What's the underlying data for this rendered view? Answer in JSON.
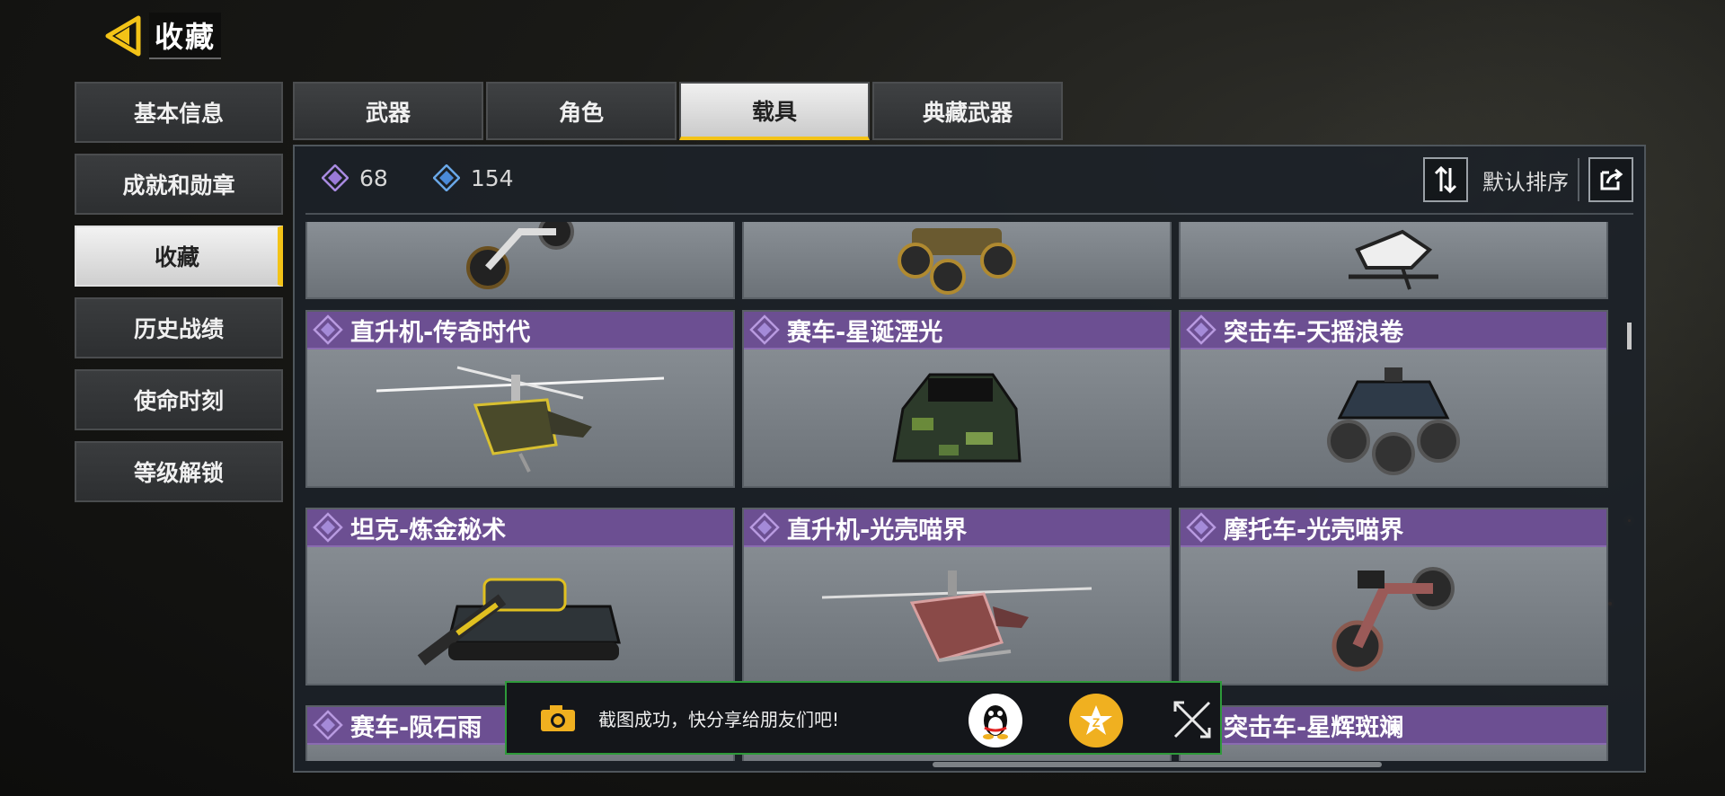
{
  "header": {
    "title": "收藏"
  },
  "side_menu": {
    "items": [
      {
        "label": "基本信息",
        "active": false
      },
      {
        "label": "成就和勋章",
        "active": false
      },
      {
        "label": "收藏",
        "active": true
      },
      {
        "label": "历史战绩",
        "active": false
      },
      {
        "label": "使命时刻",
        "active": false
      },
      {
        "label": "等级解锁",
        "active": false
      }
    ]
  },
  "tabs": [
    {
      "label": "武器",
      "active": false
    },
    {
      "label": "角色",
      "active": false
    },
    {
      "label": "载具",
      "active": true
    },
    {
      "label": "典藏武器",
      "active": false
    }
  ],
  "stats": {
    "purple_count": "68",
    "blue_count": "154"
  },
  "sort": {
    "label": "默认排序"
  },
  "vehicles": [
    {
      "name": "",
      "icon": "motorcycle-icon"
    },
    {
      "name": "",
      "icon": "atv-icon"
    },
    {
      "name": "",
      "icon": "snowmobile-icon"
    },
    {
      "name": "直升机-传奇时代",
      "icon": "helicopter-icon"
    },
    {
      "name": "赛车-星诞湮光",
      "icon": "race-car-icon"
    },
    {
      "name": "突击车-天摇浪卷",
      "icon": "assault-vehicle-icon"
    },
    {
      "name": "坦克-炼金秘术",
      "icon": "tank-icon"
    },
    {
      "name": "直升机-光壳喵界",
      "icon": "helicopter-icon"
    },
    {
      "name": "摩托车-光壳喵界",
      "icon": "motorcycle-icon"
    },
    {
      "name": "赛车-陨石雨",
      "icon": "race-car-icon"
    },
    {
      "name": "",
      "icon": "unknown"
    },
    {
      "name": "突击车-星辉斑斓",
      "icon": "assault-vehicle-icon"
    }
  ],
  "toast": {
    "message": "截图成功，快分享给朋友们吧!"
  },
  "colors": {
    "accent_yellow": "#f3c317",
    "rarity_purple": "#6c4f92",
    "toast_border": "#2e9a3a"
  }
}
